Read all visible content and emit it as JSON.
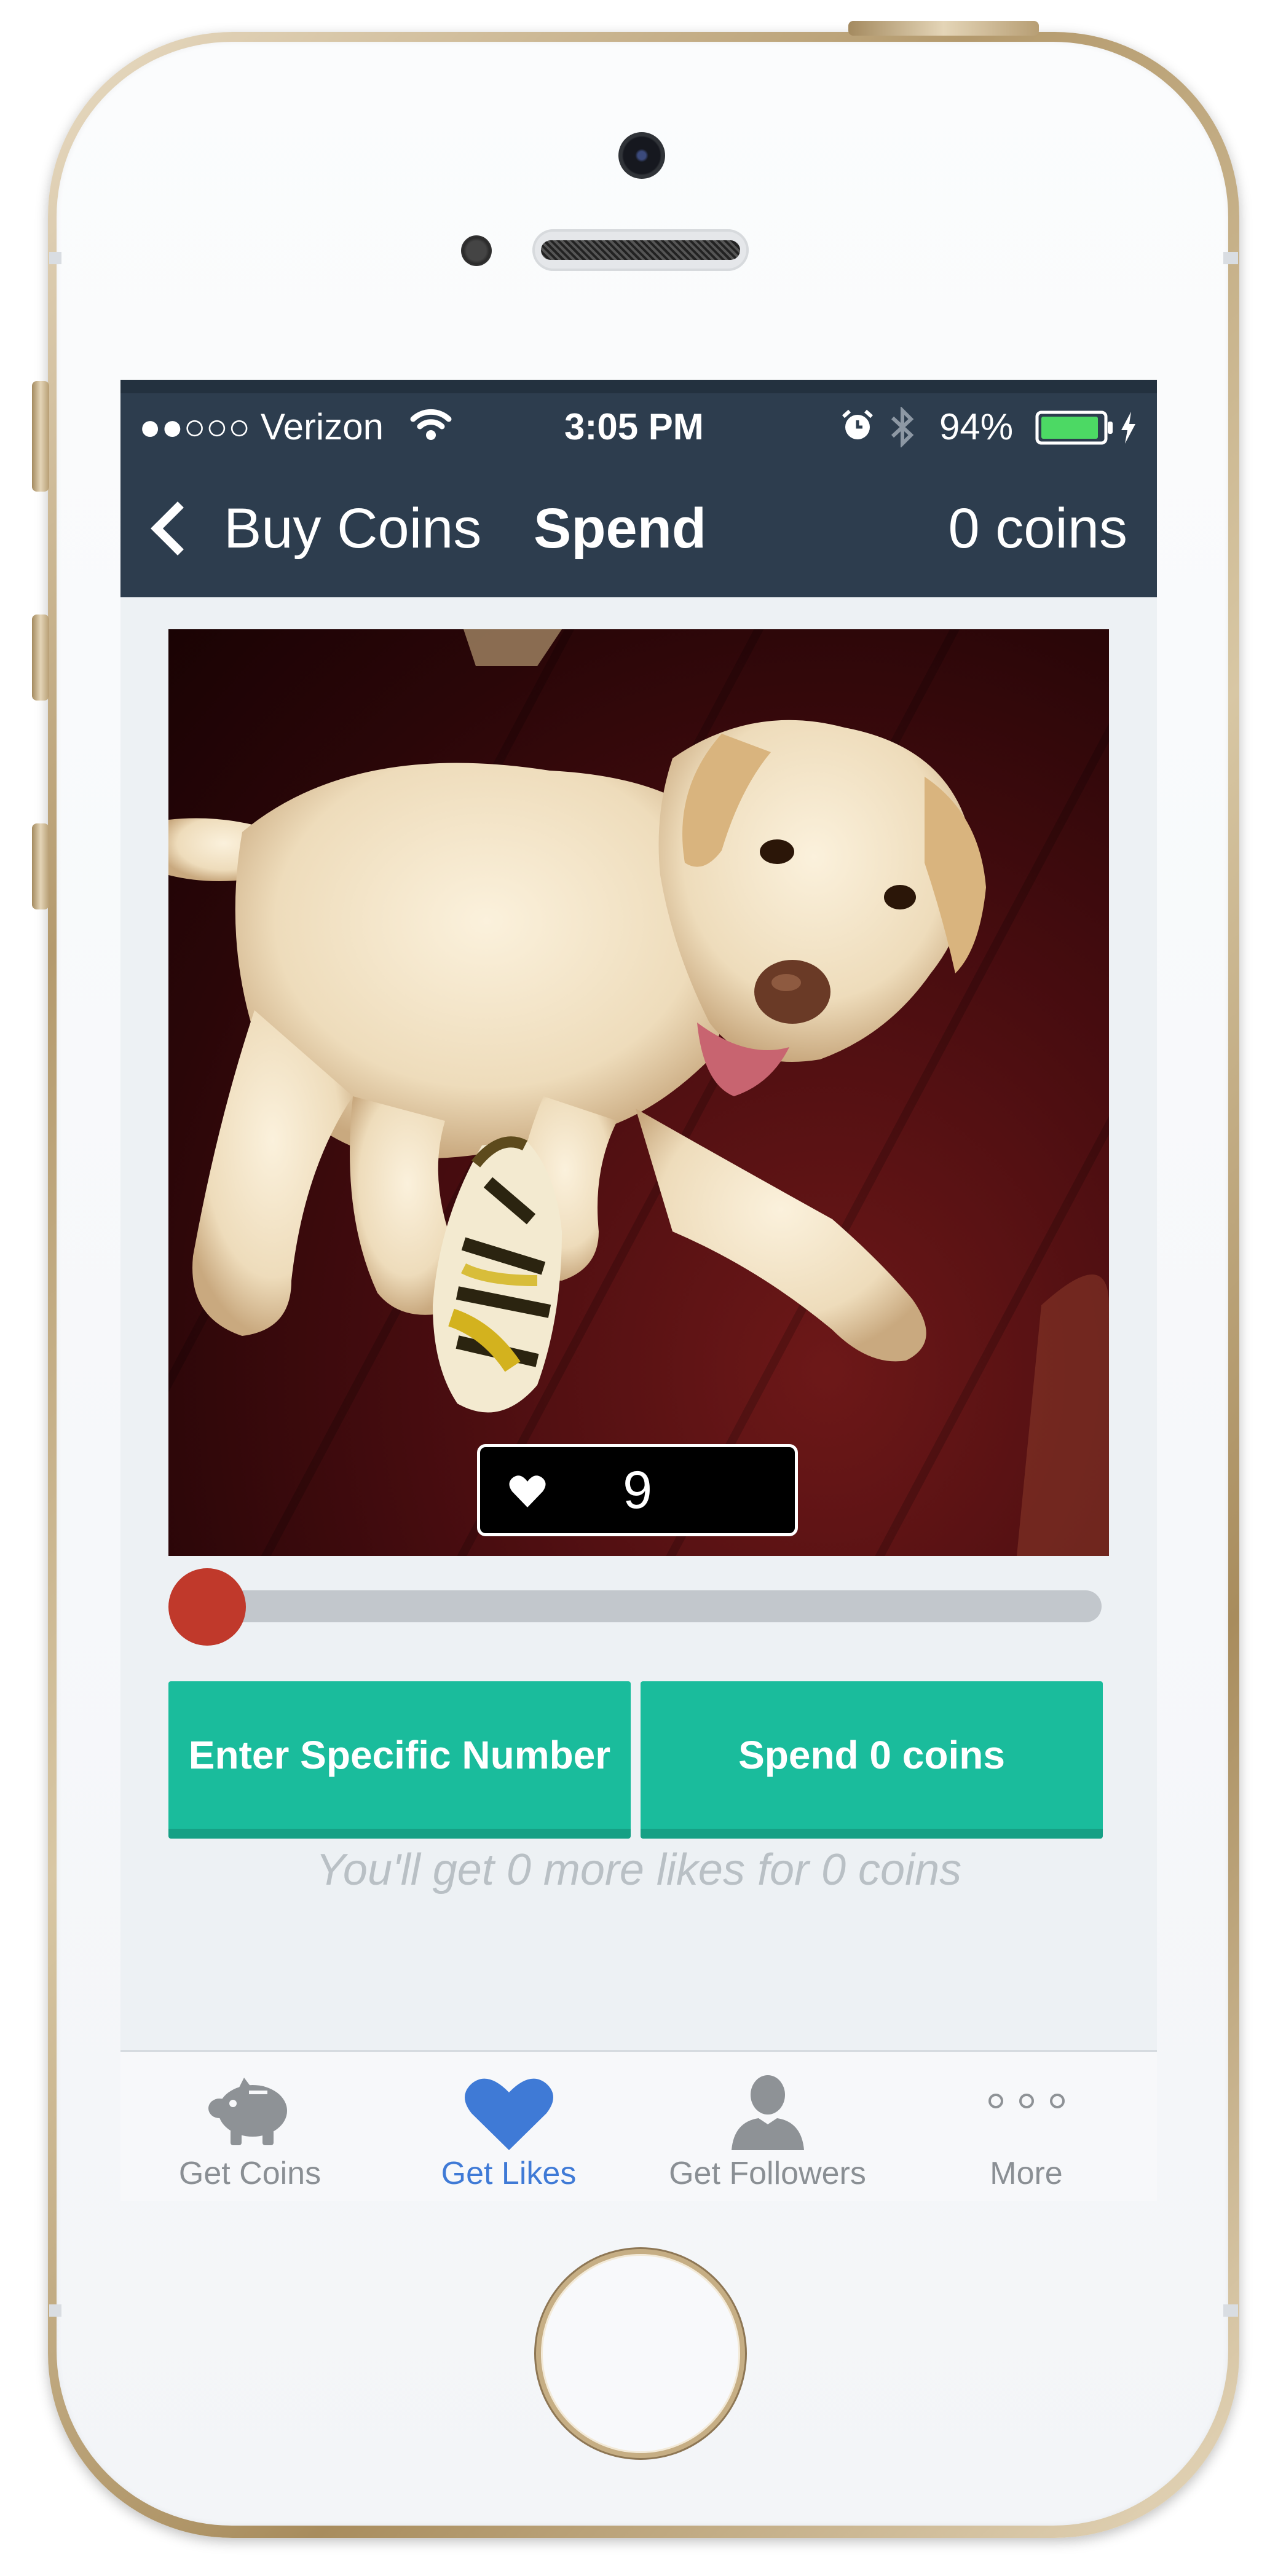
{
  "status_bar": {
    "carrier": "●●○○○ Verizon",
    "time": "3:05 PM",
    "battery_percent": "94%",
    "battery_level": 0.94,
    "icons": [
      "wifi-icon",
      "alarm-icon",
      "bluetooth-icon",
      "battery-icon",
      "charging-icon"
    ]
  },
  "nav": {
    "back_label": "Buy Coins",
    "title": "Spend",
    "coins": "0 coins"
  },
  "photo": {
    "likes_count": "9",
    "icon": "heart-icon"
  },
  "slider": {
    "value": 0
  },
  "buttons": {
    "enter_number": "Enter Specific Number",
    "spend": "Spend 0 coins"
  },
  "hint": "You'll get 0 more likes for 0 coins",
  "tabs": [
    {
      "label": "Get Coins",
      "icon": "piggy-bank-icon",
      "active": false
    },
    {
      "label": "Get Likes",
      "icon": "heart-icon",
      "active": true
    },
    {
      "label": "Get Followers",
      "icon": "person-icon",
      "active": false
    },
    {
      "label": "More",
      "icon": "more-dots-icon",
      "active": false
    }
  ],
  "colors": {
    "nav_background": "#2d3d4e",
    "accent_green": "#1abc9c",
    "slider_thumb": "#c0392b",
    "tab_active": "#3f7ad6",
    "battery_fill": "#4cd964"
  }
}
